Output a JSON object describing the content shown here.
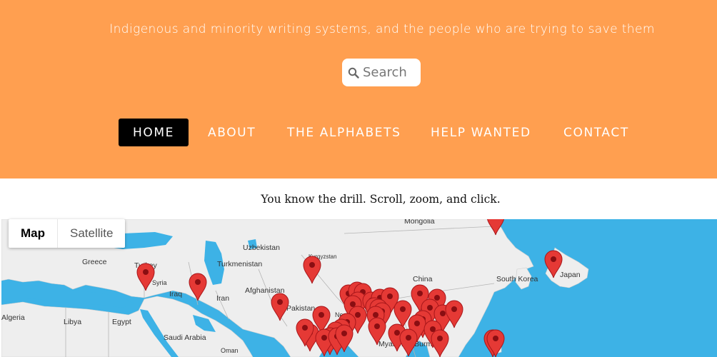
{
  "header": {
    "tagline": "Indigenous and minority writing systems, and the people who are trying to save them",
    "search": {
      "placeholder": "Search"
    },
    "nav": [
      {
        "label": "HOME",
        "active": true
      },
      {
        "label": "ABOUT"
      },
      {
        "label": "THE ALPHABETS"
      },
      {
        "label": "HELP WANTED"
      },
      {
        "label": "CONTACT"
      }
    ],
    "accent_color": "#ff9f50"
  },
  "intro": "You know the drill. Scroll, zoom, and click.",
  "map": {
    "type_buttons": [
      {
        "label": "Map",
        "selected": true
      },
      {
        "label": "Satellite"
      }
    ],
    "water_color": "#3db2e6",
    "land_color": "#eeeeee",
    "marker_color": "#e53935",
    "labels": {
      "mongolia": "Mongolia",
      "greece": "Greece",
      "turkey": "Turkey",
      "uzbekistan": "Uzbekistan",
      "turkmenistan": "Turkmenistan",
      "kyrgyzstan": "Kyrgyzstan",
      "syria": "Syria",
      "iraq": "Iraq",
      "iran": "Iran",
      "afghanistan": "Afghanistan",
      "pakistan": "Pakistan",
      "china": "China",
      "south_korea": "South Korea",
      "japan": "Japan",
      "algeria": "Algeria",
      "libya": "Libya",
      "egypt": "Egypt",
      "saudi_arabia": "Saudi Arabia",
      "oman": "Oman",
      "nepal": "Nep",
      "myanmar": "Myanmar (Burma)"
    }
  }
}
